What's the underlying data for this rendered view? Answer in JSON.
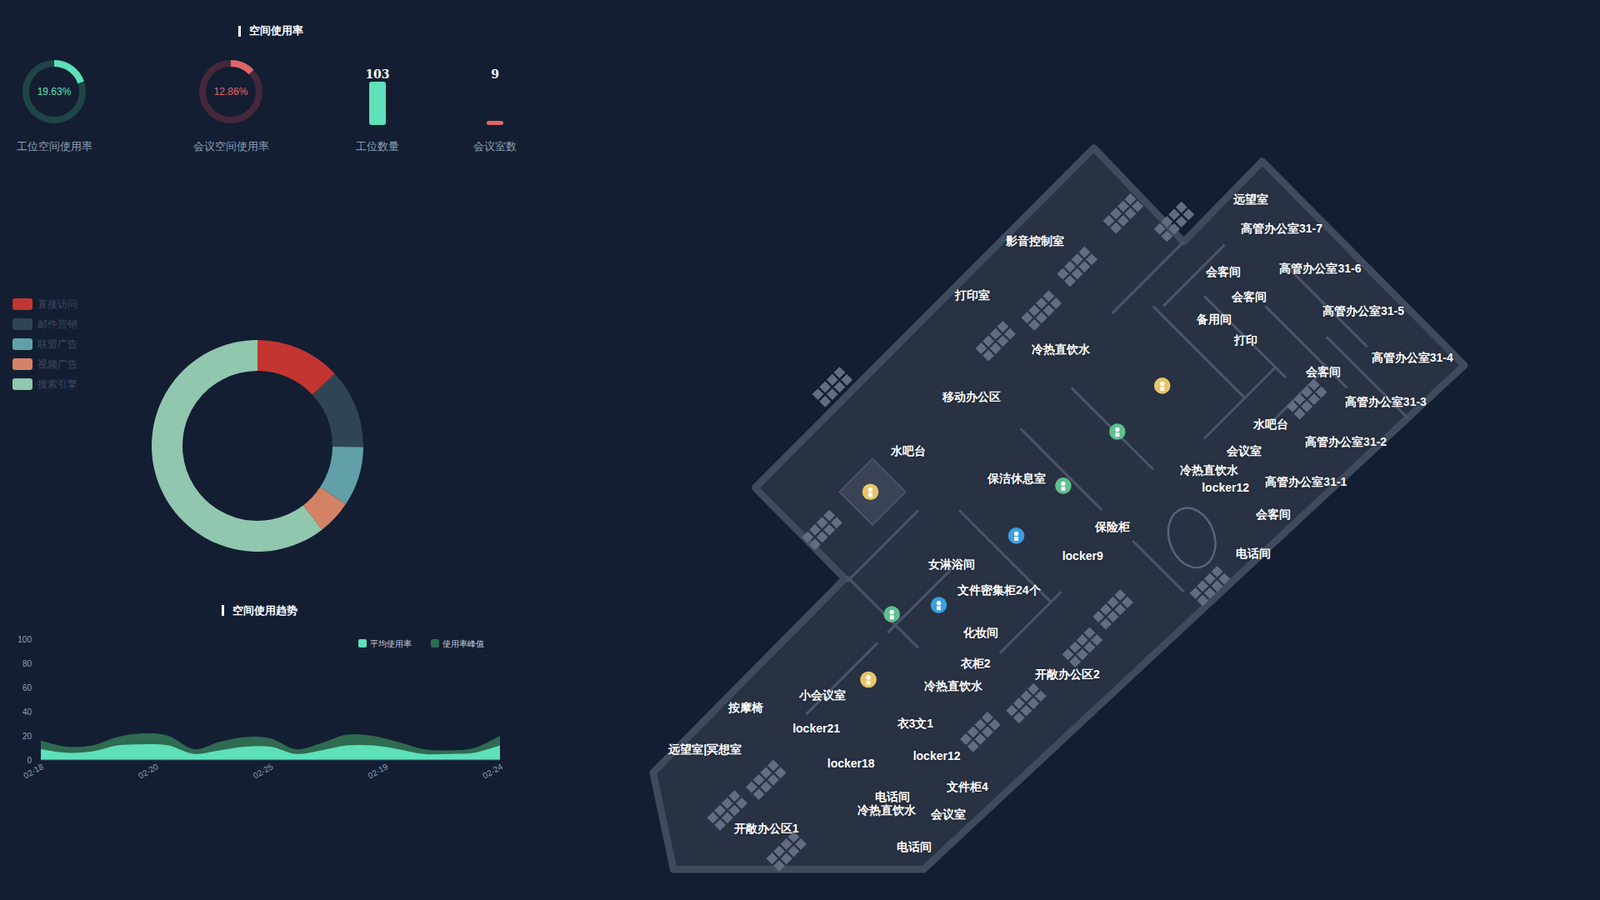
{
  "usage": {
    "title": "空间使用率",
    "kpis": [
      {
        "kind": "ring",
        "value": "19.63%",
        "label": "工位空间使用率",
        "level": 0.1963,
        "color": "#5ee0b8"
      },
      {
        "kind": "ring",
        "value": "12.86%",
        "label": "会议空间使用率",
        "level": 0.1286,
        "color": "#e06666"
      },
      {
        "kind": "bar",
        "value": "103",
        "label": "工位数量",
        "level": 1,
        "color": "#5ee0b8"
      },
      {
        "kind": "bar",
        "value": "9",
        "label": "会议室数",
        "level": 0.087,
        "color": "#e06666"
      }
    ]
  },
  "pie": {
    "legend": [
      {
        "label": "直接访问",
        "color": "#c23531",
        "value": 335
      },
      {
        "label": "邮件营销",
        "color": "#2f4554",
        "value": 310
      },
      {
        "label": "联盟广告",
        "color": "#61a0a8",
        "value": 234
      },
      {
        "label": "视频广告",
        "color": "#d48265",
        "value": 135
      },
      {
        "label": "搜索引擎",
        "color": "#91c7ae",
        "value": 1548
      }
    ]
  },
  "trend": {
    "title": "空间使用趋势",
    "y_ticks": [
      "100",
      "80",
      "60",
      "40",
      "20",
      "0"
    ],
    "x_labels": [
      "02-18",
      "02-20",
      "02-25",
      "02-19",
      "02-24"
    ],
    "series": [
      {
        "name": "平均使用率",
        "color": "#5ee0b8",
        "values": [
          9,
          6,
          7,
          12,
          13,
          12,
          5,
          8,
          11,
          11,
          5,
          8,
          12,
          12,
          9,
          5,
          5,
          6,
          12
        ]
      },
      {
        "name": "使用率峰值",
        "color": "#2e6b50",
        "values": [
          16,
          11,
          12,
          19,
          22,
          20,
          9,
          15,
          19,
          18,
          9,
          14,
          21,
          20,
          15,
          9,
          8,
          10,
          20
        ]
      }
    ]
  },
  "map": {
    "labels": [
      "影音控制室",
      "打印室",
      "冷热直饮水",
      "移动办公区",
      "水吧台",
      "保洁休息室",
      "保险柜",
      "locker9",
      "女淋浴间",
      "文件密集柜24个",
      "化妆间",
      "衣柜2",
      "开敞办公区2",
      "冷热直饮水",
      "小会议室",
      "按摩椅",
      "衣3文1",
      "locker21",
      "远望室|冥想室",
      "locker18",
      "locker12",
      "文件柜4",
      "电话间",
      "冷热直饮水",
      "会议室",
      "开敞办公区1",
      "电话间",
      "远望室",
      "高管办公室31-7",
      "会客间",
      "高管办公室31-6",
      "会客间",
      "备用间",
      "高管办公室31-5",
      "打印",
      "会客间",
      "高管办公室31-4",
      "高管办公室31-3",
      "水吧台",
      "会议室",
      "高管办公室31-2",
      "冷热直饮水",
      "locker12",
      "高管办公室31-1",
      "会客间",
      "电话间"
    ]
  }
}
